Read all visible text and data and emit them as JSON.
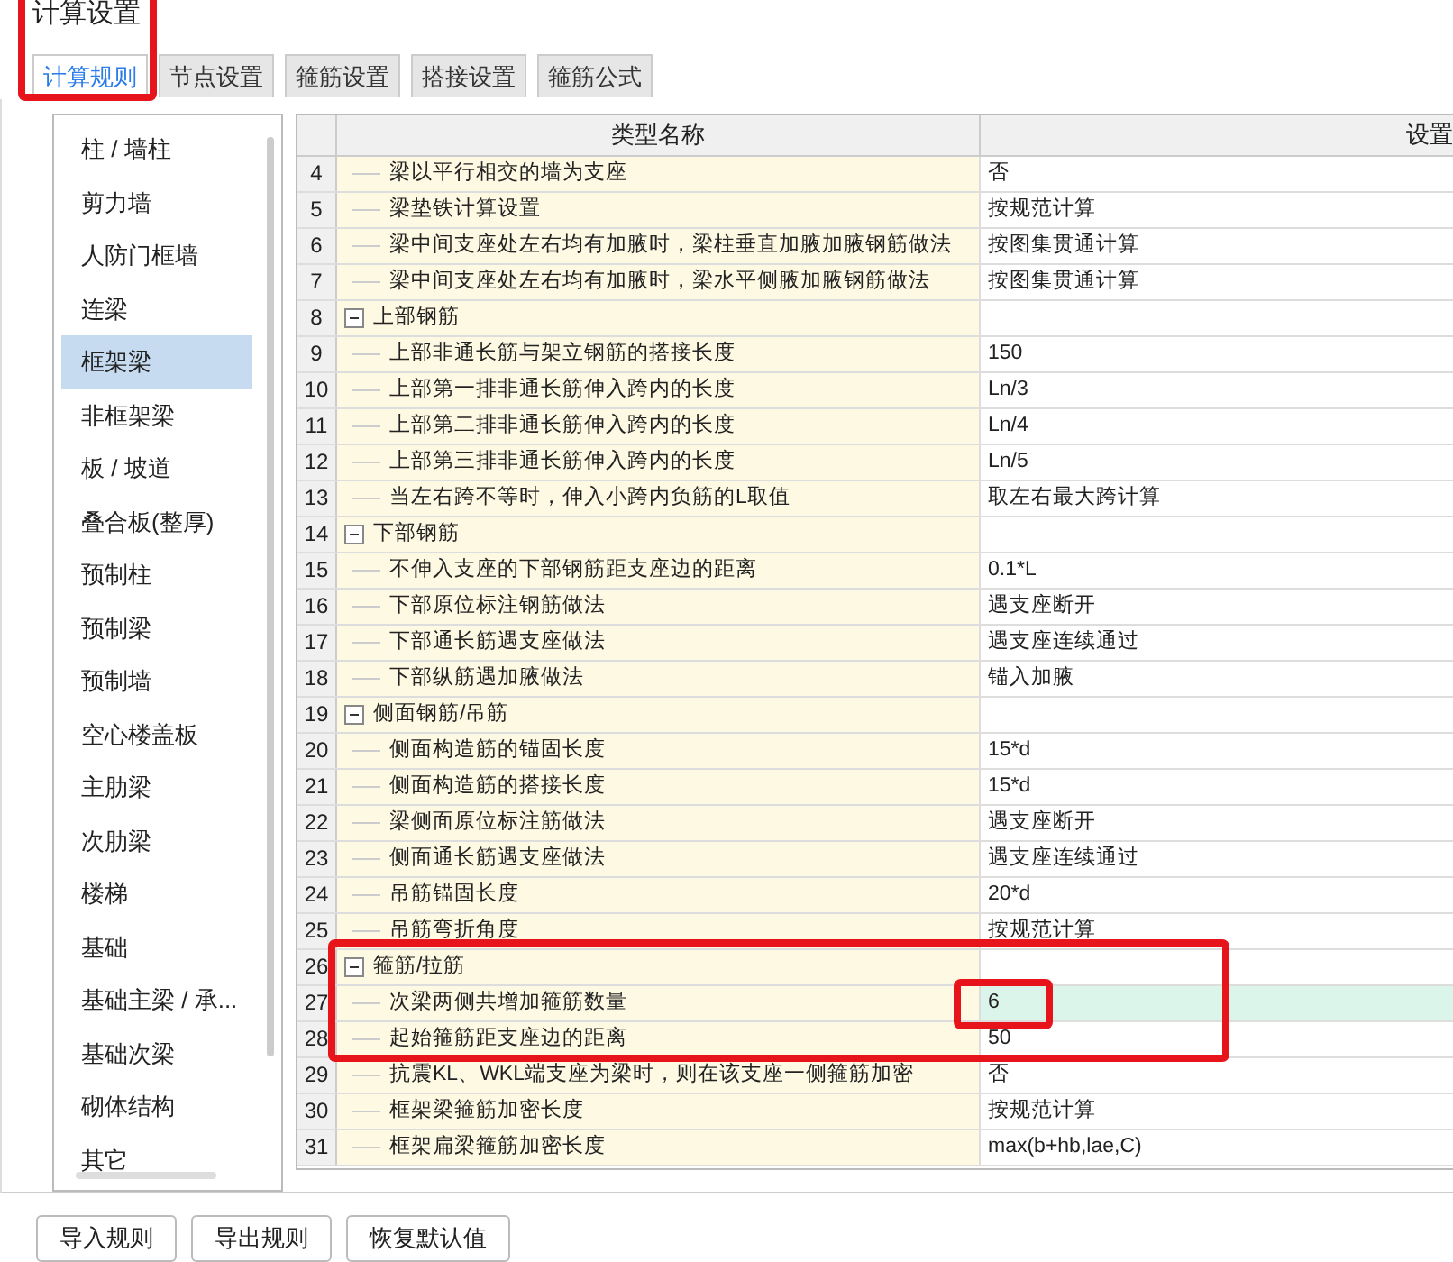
{
  "window": {
    "title": "计算设置"
  },
  "tabs": [
    {
      "label": "计算规则",
      "selected": true,
      "marked": true
    },
    {
      "label": "节点设置",
      "selected": false
    },
    {
      "label": "箍筋设置",
      "selected": false
    },
    {
      "label": "搭接设置",
      "selected": false
    },
    {
      "label": "箍筋公式",
      "selected": false
    }
  ],
  "sidebar": {
    "items": [
      {
        "label": "柱 / 墙柱",
        "selected": false
      },
      {
        "label": "剪力墙",
        "selected": false
      },
      {
        "label": "人防门框墙",
        "selected": false
      },
      {
        "label": "连梁",
        "selected": false
      },
      {
        "label": "框架梁",
        "selected": true
      },
      {
        "label": "非框架梁",
        "selected": false
      },
      {
        "label": "板 / 坡道",
        "selected": false
      },
      {
        "label": "叠合板(整厚)",
        "selected": false
      },
      {
        "label": "预制柱",
        "selected": false
      },
      {
        "label": "预制梁",
        "selected": false
      },
      {
        "label": "预制墙",
        "selected": false
      },
      {
        "label": "空心楼盖板",
        "selected": false
      },
      {
        "label": "主肋梁",
        "selected": false
      },
      {
        "label": "次肋梁",
        "selected": false
      },
      {
        "label": "楼梯",
        "selected": false
      },
      {
        "label": "基础",
        "selected": false
      },
      {
        "label": "基础主梁 / 承...",
        "selected": false
      },
      {
        "label": "基础次梁",
        "selected": false
      },
      {
        "label": "砌体结构",
        "selected": false
      },
      {
        "label": "其它",
        "selected": false
      }
    ]
  },
  "table": {
    "columns": [
      "类型名称",
      "设置"
    ],
    "rows": [
      {
        "kind": "item",
        "number": "4",
        "name": "梁以平行相交的墙为支座",
        "value": "否",
        "selected": false
      },
      {
        "kind": "item",
        "number": "5",
        "name": "梁垫铁计算设置",
        "value": "按规范计算",
        "selected": false
      },
      {
        "kind": "item",
        "number": "6",
        "name": "梁中间支座处左右均有加腋时，梁柱垂直加腋加腋钢筋做法",
        "value": "按图集贯通计算",
        "selected": false
      },
      {
        "kind": "item",
        "number": "7",
        "name": "梁中间支座处左右均有加腋时，梁水平侧腋加腋钢筋做法",
        "value": "按图集贯通计算",
        "selected": false
      },
      {
        "kind": "group",
        "number": "8",
        "name": "上部钢筋",
        "expanded": true,
        "children": [
          {
            "kind": "item",
            "number": "9",
            "name": "上部非通长筋与架立钢筋的搭接长度",
            "value": "150",
            "selected": false
          },
          {
            "kind": "item",
            "number": "10",
            "name": "上部第一排非通长筋伸入跨内的长度",
            "value": "Ln/3",
            "selected": false
          },
          {
            "kind": "item",
            "number": "11",
            "name": "上部第二排非通长筋伸入跨内的长度",
            "value": "Ln/4",
            "selected": false
          },
          {
            "kind": "item",
            "number": "12",
            "name": "上部第三排非通长筋伸入跨内的长度",
            "value": "Ln/5",
            "selected": false
          },
          {
            "kind": "item",
            "number": "13",
            "name": "当左右跨不等时，伸入小跨内负筋的L取值",
            "value": "取左右最大跨计算",
            "selected": false
          }
        ]
      },
      {
        "kind": "group",
        "number": "14",
        "name": "下部钢筋",
        "expanded": true,
        "children": [
          {
            "kind": "item",
            "number": "15",
            "name": "不伸入支座的下部钢筋距支座边的距离",
            "value": "0.1*L",
            "selected": false
          },
          {
            "kind": "item",
            "number": "16",
            "name": "下部原位标注钢筋做法",
            "value": "遇支座断开",
            "selected": false
          },
          {
            "kind": "item",
            "number": "17",
            "name": "下部通长筋遇支座做法",
            "value": "遇支座连续通过",
            "selected": false
          },
          {
            "kind": "item",
            "number": "18",
            "name": "下部纵筋遇加腋做法",
            "value": "锚入加腋",
            "selected": false
          }
        ]
      },
      {
        "kind": "group",
        "number": "19",
        "name": "侧面钢筋/吊筋",
        "expanded": true,
        "children": [
          {
            "kind": "item",
            "number": "20",
            "name": "侧面构造筋的锚固长度",
            "value": "15*d",
            "selected": false
          },
          {
            "kind": "item",
            "number": "21",
            "name": "侧面构造筋的搭接长度",
            "value": "15*d",
            "selected": false
          },
          {
            "kind": "item",
            "number": "22",
            "name": "梁侧面原位标注筋做法",
            "value": "遇支座断开",
            "selected": false
          },
          {
            "kind": "item",
            "number": "23",
            "name": "侧面通长筋遇支座做法",
            "value": "遇支座连续通过",
            "selected": false
          },
          {
            "kind": "item",
            "number": "24",
            "name": "吊筋锚固长度",
            "value": "20*d",
            "selected": false
          },
          {
            "kind": "item",
            "number": "25",
            "name": "吊筋弯折角度",
            "value": "按规范计算",
            "selected": false
          }
        ]
      },
      {
        "kind": "group",
        "number": "26",
        "name": "箍筋/拉筋",
        "expanded": true,
        "marked": true,
        "children": [
          {
            "kind": "item",
            "number": "27",
            "name": "次梁两侧共增加箍筋数量",
            "value": "6",
            "selected": true,
            "marked": true,
            "value_marked": true
          },
          {
            "kind": "item",
            "number": "28",
            "name": "起始箍筋距支座边的距离",
            "value": "50",
            "selected": false,
            "marked": true
          },
          {
            "kind": "item",
            "number": "29",
            "name": "抗震KL、WKL端支座为梁时，则在该支座一侧箍筋加密",
            "value": "否",
            "selected": false
          },
          {
            "kind": "item",
            "number": "30",
            "name": "框架梁箍筋加密长度",
            "value": "按规范计算",
            "selected": false
          },
          {
            "kind": "item",
            "number": "31",
            "name": "框架扁梁箍筋加密长度",
            "value": "max(b+hb,lae,C)",
            "selected": false
          }
        ]
      }
    ]
  },
  "buttons": [
    "导入规则",
    "导出规则",
    "恢复默认值"
  ]
}
